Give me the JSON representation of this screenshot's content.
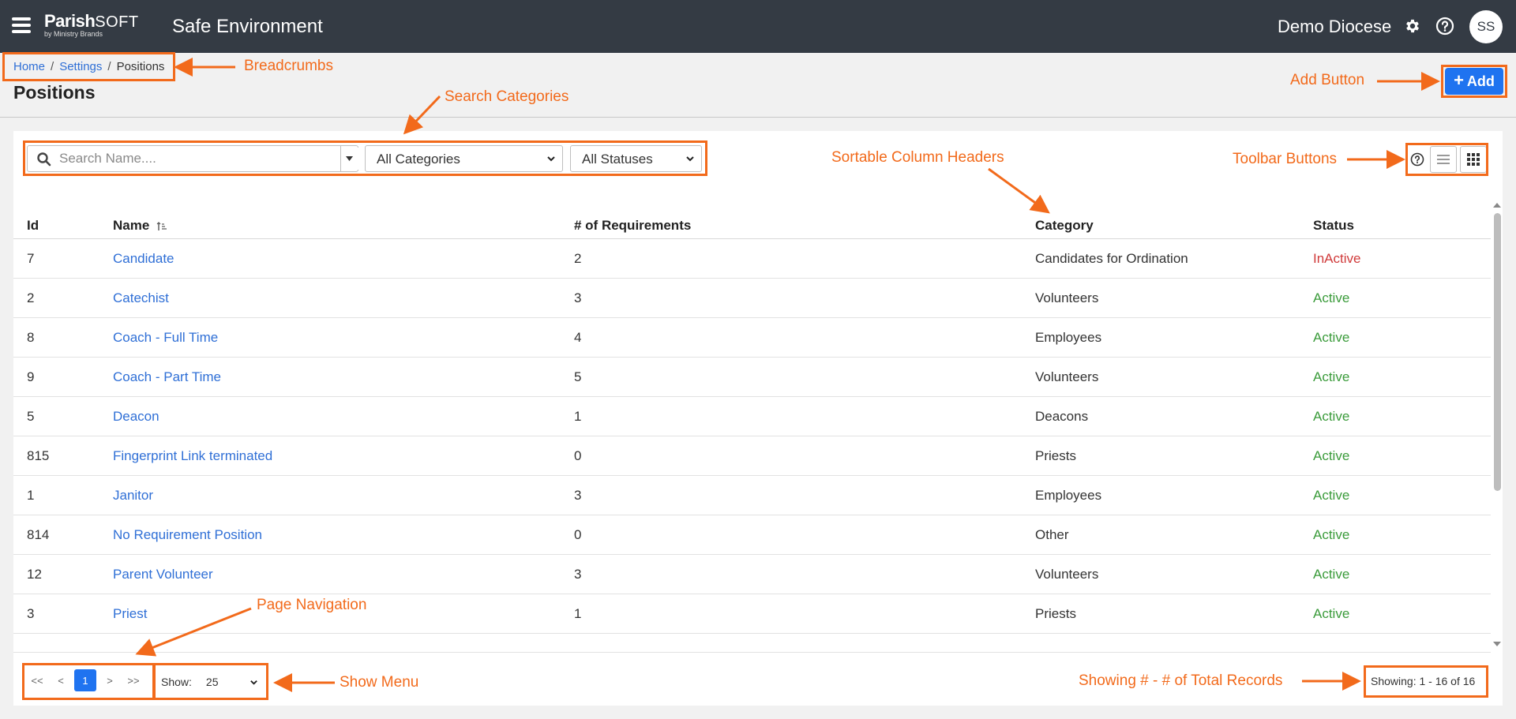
{
  "app": {
    "brand_main": "Parish",
    "brand_soft": "SOFT",
    "brand_sub": "by Ministry Brands",
    "title": "Safe Environment",
    "org_name": "Demo Diocese",
    "user_initials": "SS"
  },
  "breadcrumb": [
    "Home",
    "Settings",
    "Positions"
  ],
  "page": {
    "title": "Positions",
    "add_label": "Add"
  },
  "filters": {
    "search_placeholder": "Search Name....",
    "category_value": "All Categories",
    "status_value": "All Statuses"
  },
  "table": {
    "headers": [
      "Id",
      "Name",
      "# of Requirements",
      "Category",
      "Status"
    ],
    "rows": [
      {
        "id": "7",
        "name": "Candidate",
        "req": "2",
        "category": "Candidates for Ordination",
        "status": "InActive"
      },
      {
        "id": "2",
        "name": "Catechist",
        "req": "3",
        "category": "Volunteers",
        "status": "Active"
      },
      {
        "id": "8",
        "name": "Coach - Full Time",
        "req": "4",
        "category": "Employees",
        "status": "Active"
      },
      {
        "id": "9",
        "name": "Coach - Part Time",
        "req": "5",
        "category": "Volunteers",
        "status": "Active"
      },
      {
        "id": "5",
        "name": "Deacon",
        "req": "1",
        "category": "Deacons",
        "status": "Active"
      },
      {
        "id": "815",
        "name": "Fingerprint Link terminated",
        "req": "0",
        "category": "Priests",
        "status": "Active"
      },
      {
        "id": "1",
        "name": "Janitor",
        "req": "3",
        "category": "Employees",
        "status": "Active"
      },
      {
        "id": "814",
        "name": "No Requirement Position",
        "req": "0",
        "category": "Other",
        "status": "Active"
      },
      {
        "id": "12",
        "name": "Parent Volunteer",
        "req": "3",
        "category": "Volunteers",
        "status": "Active"
      },
      {
        "id": "3",
        "name": "Priest",
        "req": "1",
        "category": "Priests",
        "status": "Active"
      }
    ]
  },
  "pagination": {
    "first": "<<",
    "prev": "<",
    "current": "1",
    "next": ">",
    "last": ">>",
    "show_label": "Show:",
    "show_value": "25",
    "showing": "Showing: 1 - 16 of 16"
  },
  "annotations": {
    "breadcrumbs": "Breadcrumbs",
    "search_categories": "Search Categories",
    "add_button": "Add Button",
    "sortable_headers": "Sortable Column Headers",
    "toolbar_buttons": "Toolbar Buttons",
    "page_navigation": "Page Navigation",
    "show_menu": "Show Menu",
    "showing_records": "Showing # - # of Total Records"
  },
  "colors": {
    "topbar": "#343b44",
    "link": "#2f6fd6",
    "primary": "#1f73f0",
    "active": "#3a9b3a",
    "inactive": "#d03a3a",
    "annotation": "#f26a1b"
  }
}
